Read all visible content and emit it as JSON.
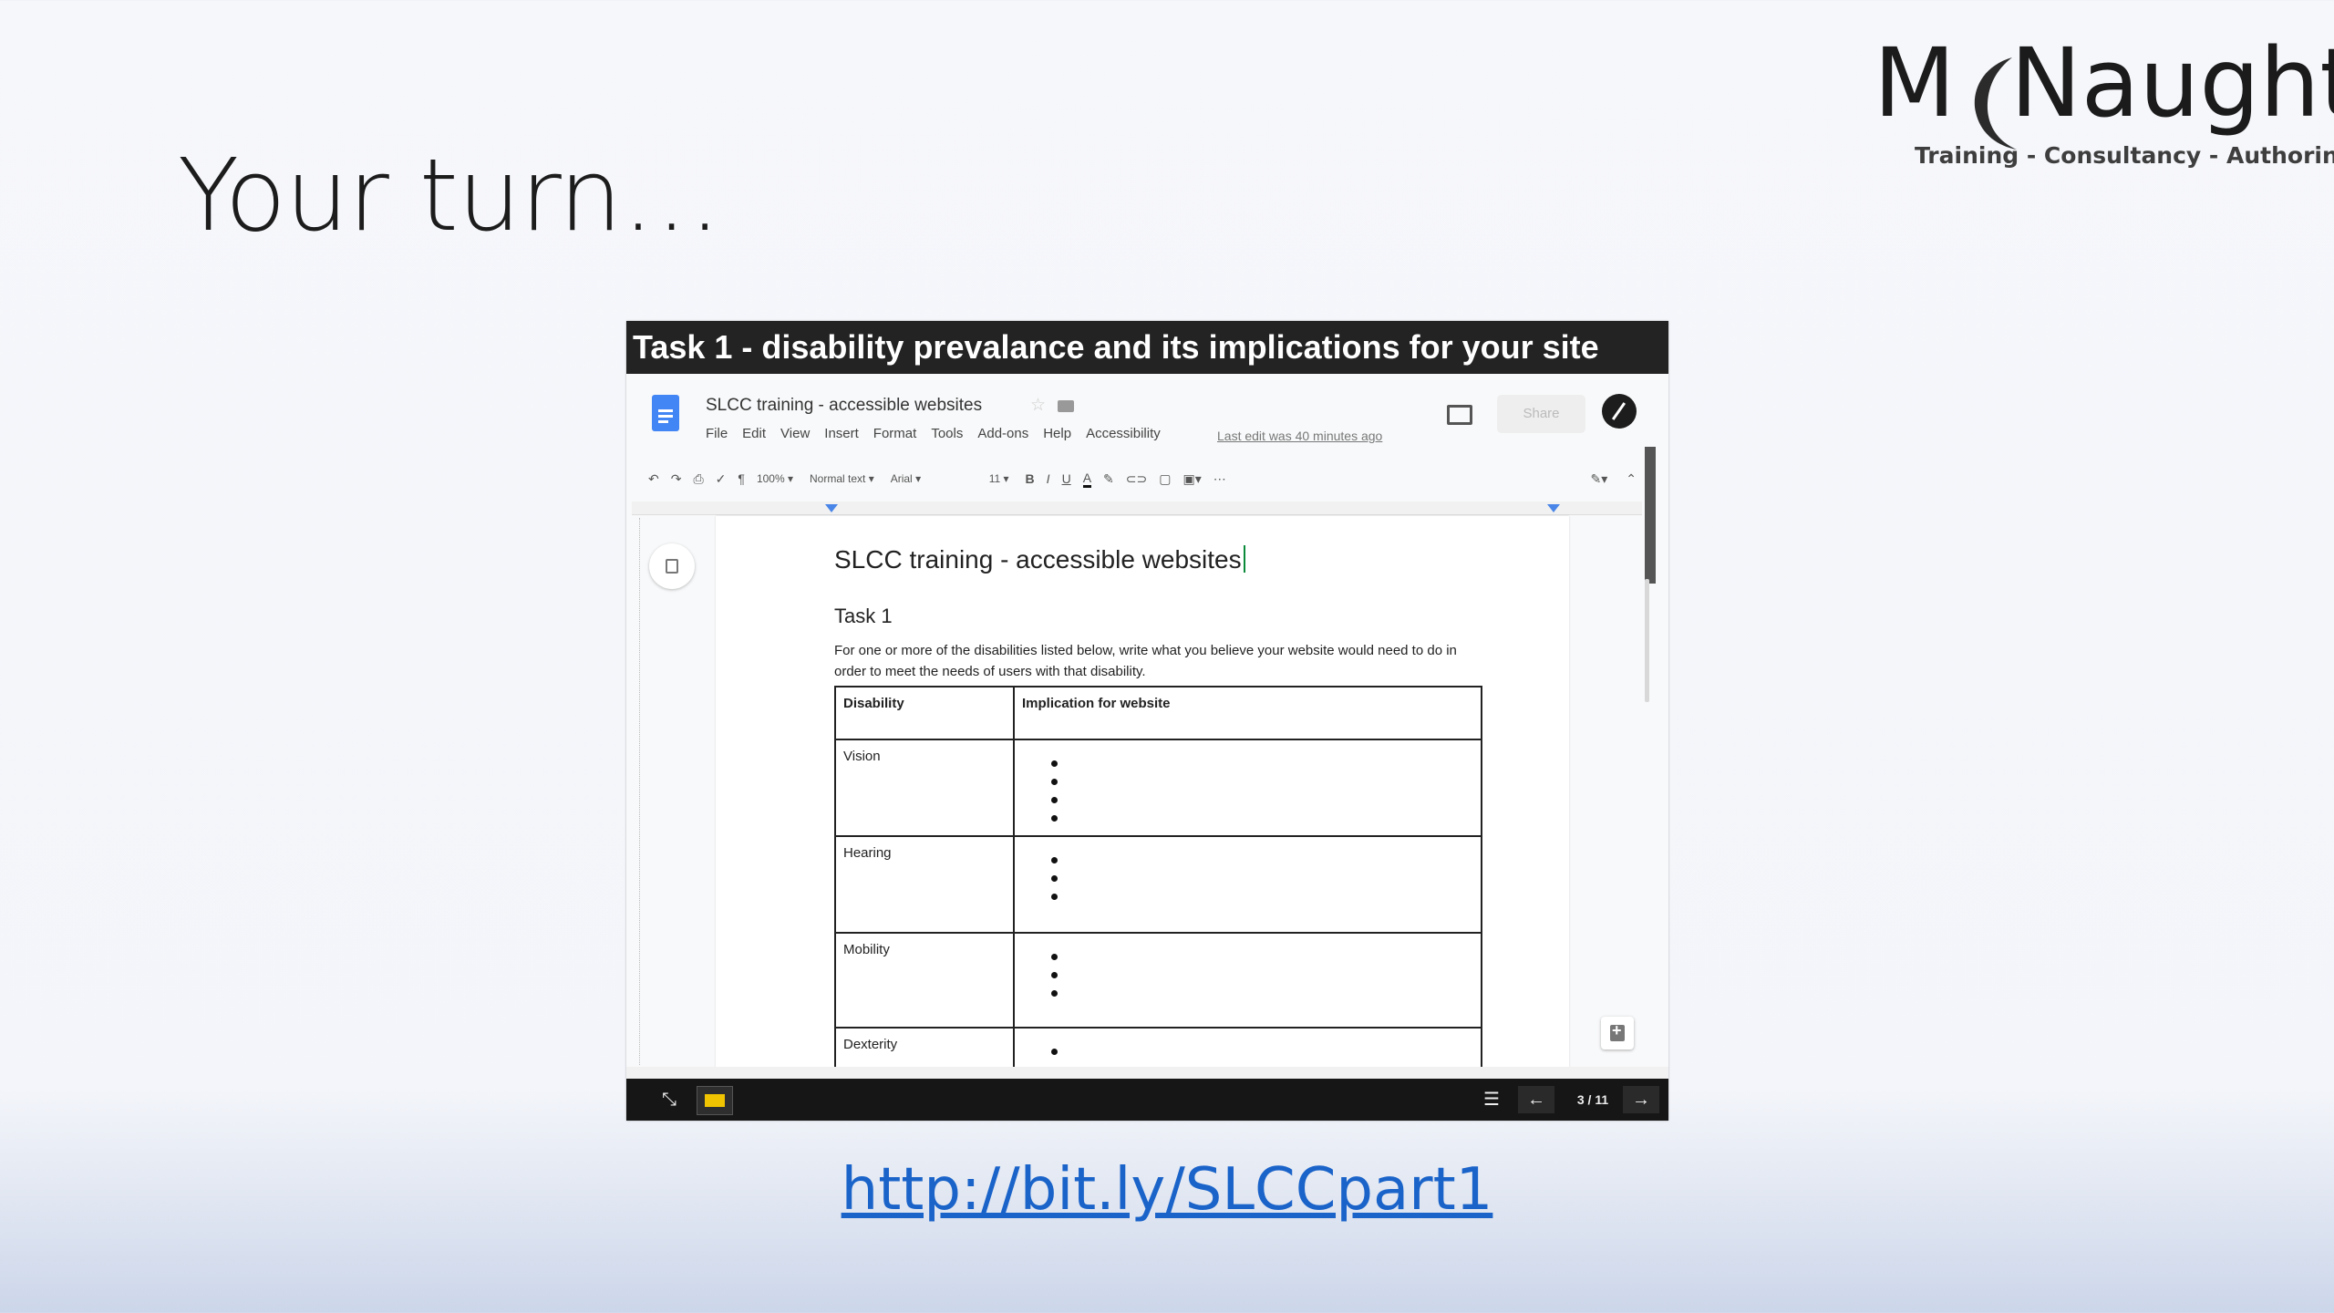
{
  "slide": {
    "title": "Your turn…",
    "link": "http://bit.ly/SLCCpart1"
  },
  "logo": {
    "brand_left": "M",
    "brand_right": "Naught",
    "tagline": "Training - Consultancy - Authoring"
  },
  "viewer": {
    "header_title": "Task 1 - disability prevalance and its implications for your site",
    "page_counter": "3 / 11"
  },
  "docs": {
    "doc_name": "SLCC training - accessible websites",
    "menu": [
      "File",
      "Edit",
      "View",
      "Insert",
      "Format",
      "Tools",
      "Add-ons",
      "Help",
      "Accessibility"
    ],
    "last_edit": "Last edit was 40 minutes ago",
    "share_label": "Share",
    "toolbar": {
      "zoom": "100%",
      "style": "Normal text",
      "font": "Arial",
      "size": "11",
      "bold": "B",
      "italic": "I",
      "underline": "U",
      "text_color": "A",
      "more": "⋯"
    },
    "document": {
      "title": "SLCC training - accessible websites",
      "task_heading": "Task 1",
      "intro": "For one or more of the disabilities listed below, write what you believe your website would need to do in order to meet the needs of users with that disability.",
      "table_headers": [
        "Disability",
        "Implication for website"
      ],
      "rows": [
        "Vision",
        "Hearing",
        "Mobility",
        "Dexterity"
      ]
    }
  },
  "colors": {
    "link": "#1a63c9",
    "docs_blue": "#4285f4",
    "viewer_bar": "#232323"
  }
}
